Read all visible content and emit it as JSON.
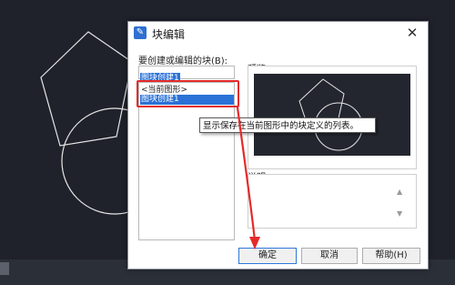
{
  "dialog": {
    "title": "块编辑",
    "block_name_label": "要创建或编辑的块(B):",
    "block_name_value": "图块创建1",
    "list_items": [
      "<当前图形>",
      "图块创建1"
    ],
    "selected_index": 1,
    "preview_label": "预览",
    "description_label": "说明",
    "tooltip": "显示保存在当前图形中的块定义的列表。",
    "buttons": {
      "ok": "确定",
      "cancel": "取消",
      "help": "帮助(H)"
    }
  },
  "icons": {
    "title_icon": "block-editor-icon",
    "close": "close-icon",
    "scroll_up": "triangle-up-icon",
    "scroll_down": "triangle-down-icon"
  },
  "colors": {
    "selection": "#2a72d8",
    "annotation": "#e52a2a",
    "canvas": "#1f222b"
  }
}
